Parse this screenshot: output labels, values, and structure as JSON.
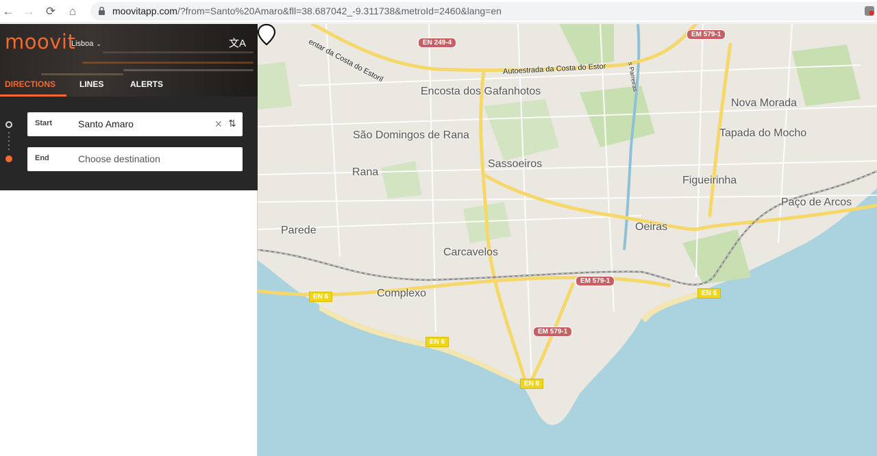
{
  "browser": {
    "url_host": "moovitapp.com",
    "url_rest": "/?from=Santo%20Amaro&fll=38.687042_-9.311738&metroId=2460&lang=en"
  },
  "header": {
    "logo": "moovit",
    "city": "Lisboa",
    "language_icon": "文A"
  },
  "tabs": [
    {
      "label": "DIRECTIONS",
      "active": true
    },
    {
      "label": "LINES",
      "active": false
    },
    {
      "label": "ALERTS",
      "active": false
    }
  ],
  "directions": {
    "start_label": "Start",
    "start_value": "Santo Amaro",
    "end_label": "End",
    "end_placeholder": "Choose destination"
  },
  "map": {
    "places": [
      "Encosta dos Gafanhotos",
      "São Domingos de Rana",
      "Sassoeiros",
      "Rana",
      "Nova Morada",
      "Tapada do Mocho",
      "Figueirinha",
      "Paço de Arcos",
      "Oeiras",
      "Parede",
      "Carcavelos",
      "Complexo"
    ],
    "roads": {
      "estoril_left": "entar da Costa do Estoril",
      "estoril_right": "Autoestrada da Costa do Estor",
      "parreiras": "s Parreiras"
    },
    "shields": {
      "en2494": "EN 249-4",
      "em5791_top": "EM 579-1",
      "em5791_mid": "EM 579-1",
      "em5791_low": "EM 579-1",
      "en6_a": "EN 6",
      "en6_b": "EN 6",
      "en6_c": "EN 6",
      "en6_d": "EN 6"
    },
    "colors": {
      "sea": "#aad3df",
      "land": "#eae8e1",
      "park": "#c8dfb2",
      "primary_road": "#f6d86a",
      "shield_red": "#c85f64",
      "shield_yellow": "#f0d51d",
      "accent": "#f26a2e"
    }
  }
}
